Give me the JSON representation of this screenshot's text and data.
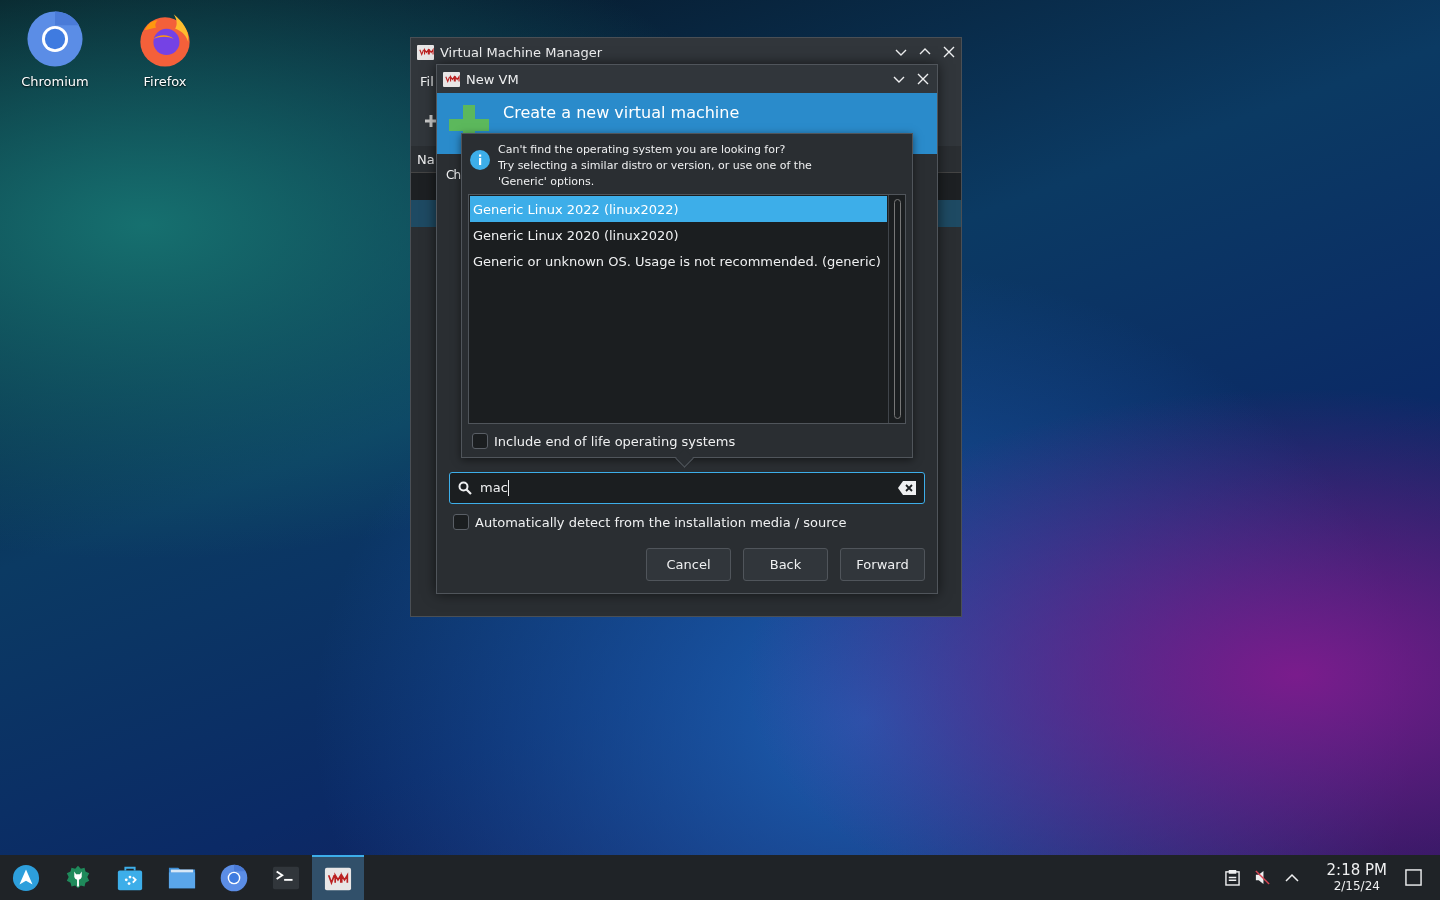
{
  "desktop_icons": [
    {
      "kind": "chromium",
      "label": "Chromium"
    },
    {
      "kind": "firefox",
      "label": "Firefox"
    }
  ],
  "main_window": {
    "title": "Virtual Machine Manager",
    "menu": [
      "Fil"
    ],
    "column_header": "Na"
  },
  "dialog": {
    "title": "New VM",
    "header": "Create a new virtual machine",
    "section_label": "Ch",
    "search": {
      "value": "mac"
    },
    "auto_detect": {
      "label": "Automatically detect from the installation media / source",
      "checked": false
    },
    "buttons": [
      "Cancel",
      "Back",
      "Forward"
    ]
  },
  "os_popover": {
    "info": "Can't find the operating system you are looking for?\nTry selecting a similar distro or version, or use one of the\n'Generic' options.",
    "items": [
      {
        "label": "Generic Linux 2022 (linux2022)",
        "selected": true
      },
      {
        "label": "Generic Linux 2020 (linux2020)",
        "selected": false
      },
      {
        "label": "Generic or unknown OS. Usage is not recommended. (generic)",
        "selected": false
      }
    ],
    "include_eol": {
      "label": "Include end of life operating systems",
      "checked": false
    }
  },
  "taskbar": {
    "apps": [
      {
        "kind": "launcher",
        "active": false
      },
      {
        "kind": "settings",
        "active": false
      },
      {
        "kind": "store",
        "active": false
      },
      {
        "kind": "files",
        "active": false
      },
      {
        "kind": "chromium",
        "active": false
      },
      {
        "kind": "terminal",
        "active": false
      },
      {
        "kind": "vmm",
        "active": true
      }
    ],
    "clock": {
      "time": "2:18 PM",
      "date": "2/15/24"
    }
  }
}
